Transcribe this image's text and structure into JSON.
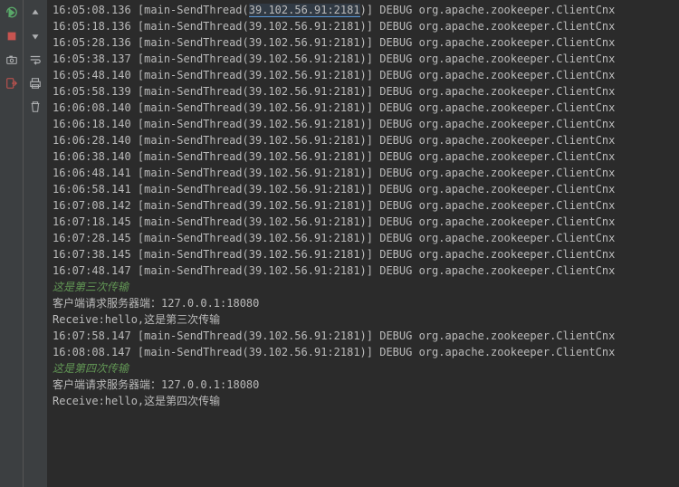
{
  "toolbar_icons": {
    "rerun": "rerun-icon",
    "stop": "stop-icon",
    "camera": "camera-icon",
    "exit": "exit-icon",
    "up": "up-icon",
    "down": "down-icon",
    "wrap": "wrap-icon",
    "print": "print-icon",
    "trash": "trash-icon"
  },
  "highlighted_ip": "39.102.56.91:2181",
  "log_first_partial": {
    "time": "16:05:08.136",
    "thread_prefix": "[main-SendThread(",
    "thread_suffix": ")]",
    "level": "DEBUG",
    "logger": "org.apache.zookeeper.ClientCnx"
  },
  "log_entries": [
    {
      "time": "16:05:18.136",
      "ip": "39.102.56.91:2181"
    },
    {
      "time": "16:05:28.136",
      "ip": "39.102.56.91:2181"
    },
    {
      "time": "16:05:38.137",
      "ip": "39.102.56.91:2181"
    },
    {
      "time": "16:05:48.140",
      "ip": "39.102.56.91:2181"
    },
    {
      "time": "16:05:58.139",
      "ip": "39.102.56.91:2181"
    },
    {
      "time": "16:06:08.140",
      "ip": "39.102.56.91:2181"
    },
    {
      "time": "16:06:18.140",
      "ip": "39.102.56.91:2181"
    },
    {
      "time": "16:06:28.140",
      "ip": "39.102.56.91:2181"
    },
    {
      "time": "16:06:38.140",
      "ip": "39.102.56.91:2181"
    },
    {
      "time": "16:06:48.141",
      "ip": "39.102.56.91:2181"
    },
    {
      "time": "16:06:58.141",
      "ip": "39.102.56.91:2181"
    },
    {
      "time": "16:07:08.142",
      "ip": "39.102.56.91:2181"
    },
    {
      "time": "16:07:18.145",
      "ip": "39.102.56.91:2181"
    },
    {
      "time": "16:07:28.145",
      "ip": "39.102.56.91:2181"
    },
    {
      "time": "16:07:38.145",
      "ip": "39.102.56.91:2181"
    },
    {
      "time": "16:07:48.147",
      "ip": "39.102.56.91:2181"
    }
  ],
  "section1": {
    "green": "这是第三次传输",
    "client_line": "客户端请求服务器端：127.0.0.1:18080",
    "receive_line": "Receive:hello,这是第三次传输"
  },
  "log_entries2": [
    {
      "time": "16:07:58.147",
      "ip": "39.102.56.91:2181"
    },
    {
      "time": "16:08:08.147",
      "ip": "39.102.56.91:2181"
    }
  ],
  "section2": {
    "green": "这是第四次传输",
    "client_line": "客户端请求服务器端：127.0.0.1:18080",
    "receive_line": "Receive:hello,这是第四次传输"
  },
  "log_common": {
    "thread_prefix": "[main-SendThread(",
    "thread_suffix": ")]",
    "level": "DEBUG",
    "logger": "org.apache.zookeeper.ClientCnx"
  }
}
